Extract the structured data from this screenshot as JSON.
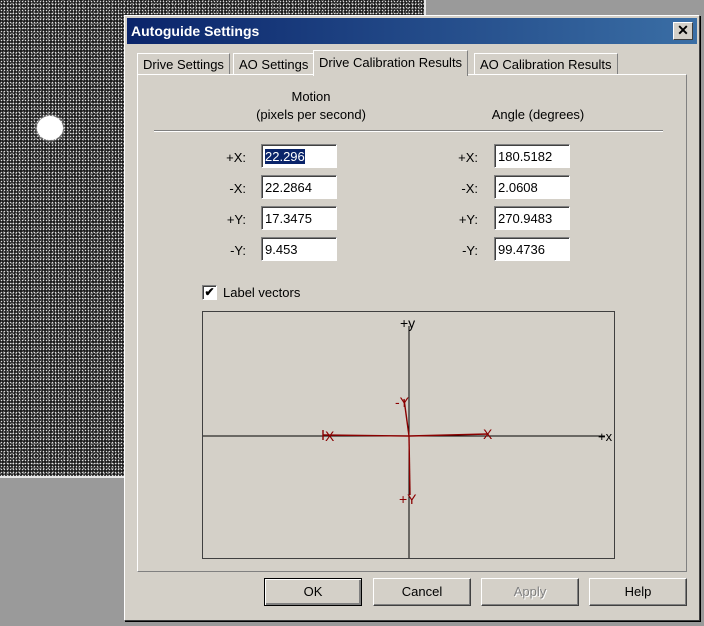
{
  "window": {
    "title": "Autoguide Settings",
    "close_glyph": "✕"
  },
  "tabs": [
    {
      "label": "Drive Settings",
      "active": false
    },
    {
      "label": "AO Settings",
      "active": false
    },
    {
      "label": "Drive Calibration Results",
      "active": true
    },
    {
      "label": "AO Calibration Results",
      "active": false
    }
  ],
  "motion": {
    "header_line1": "Motion",
    "header_line2": "(pixels per second)",
    "rows": [
      {
        "label": "+X:",
        "value": "22.296"
      },
      {
        "label": "-X:",
        "value": "22.2864"
      },
      {
        "label": "+Y:",
        "value": "17.3475"
      },
      {
        "label": "-Y:",
        "value": "9.453"
      }
    ]
  },
  "angle": {
    "header": "Angle (degrees)",
    "rows": [
      {
        "label": "+X:",
        "value": "180.5182"
      },
      {
        "label": "-X:",
        "value": "2.0608"
      },
      {
        "label": "+Y:",
        "value": "270.9483"
      },
      {
        "label": "-Y:",
        "value": "99.4736"
      }
    ]
  },
  "label_vectors": {
    "checked": true,
    "label": "Label vectors",
    "check_glyph": "✔"
  },
  "plot": {
    "axis_x_label": "+x",
    "axis_y_label": "+y",
    "vector_labels": {
      "plus_x": "X",
      "minus_x": "X",
      "plus_y": "+Y",
      "minus_y": "-Y"
    },
    "vector_color": "#8b0000"
  },
  "buttons": {
    "ok": "OK",
    "cancel": "Cancel",
    "apply": "Apply",
    "help": "Help"
  }
}
